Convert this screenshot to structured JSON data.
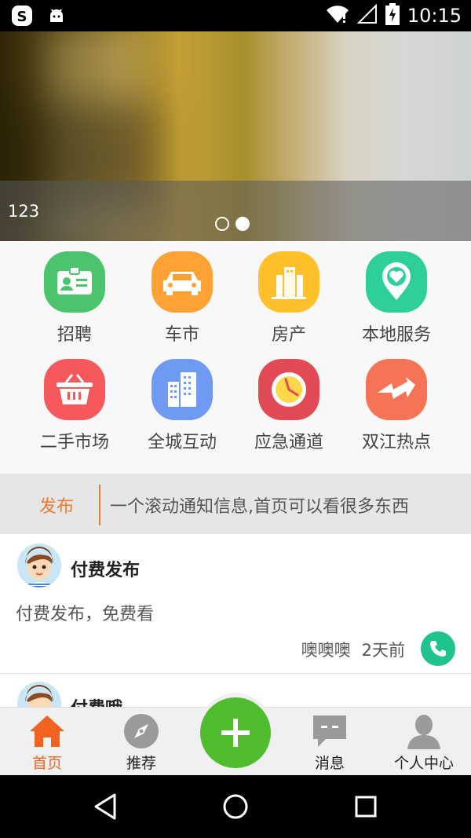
{
  "status_bar": {
    "time": "10:15",
    "icons": [
      "sogou-input-icon",
      "android-icon",
      "wifi-icon",
      "signal-icon",
      "battery-charging-icon"
    ]
  },
  "banner": {
    "caption": "123",
    "page_count": 2,
    "active_index": 1
  },
  "categories": [
    {
      "label": "招聘",
      "icon": "id-card-icon",
      "color": "#4cc46e"
    },
    {
      "label": "车市",
      "icon": "car-icon",
      "color": "#ffa235"
    },
    {
      "label": "房产",
      "icon": "building-icon",
      "color": "#ffc02a"
    },
    {
      "label": "本地服务",
      "icon": "map-pin-heart-icon",
      "color": "#2fcf98"
    },
    {
      "label": "二手市场",
      "icon": "basket-icon",
      "color": "#f5595c"
    },
    {
      "label": "全城互动",
      "icon": "city-icon",
      "color": "#6f9af4"
    },
    {
      "label": "应急通道",
      "icon": "clock-icon",
      "color": "#e24a55"
    },
    {
      "label": "双江热点",
      "icon": "lightning-icon",
      "color": "#f47455"
    }
  ],
  "notice": {
    "tag": "发布",
    "text": "一个滚动通知信息,首页可以看很多东西"
  },
  "posts": [
    {
      "title": "付费发布",
      "body": "付费发布，免费看",
      "author": "噢噢噢",
      "time": "2天前"
    },
    {
      "title": "付费哦"
    }
  ],
  "tabs": [
    {
      "label": "首页",
      "icon": "home-icon",
      "active": true
    },
    {
      "label": "推荐",
      "icon": "compass-icon",
      "active": false
    },
    {
      "label": "消息",
      "icon": "message-icon",
      "active": false
    },
    {
      "label": "个人中心",
      "icon": "person-icon",
      "active": false
    }
  ],
  "colors": {
    "accent": "#f26322",
    "fab": "#4fbd2e",
    "phone": "#1fc48d"
  }
}
